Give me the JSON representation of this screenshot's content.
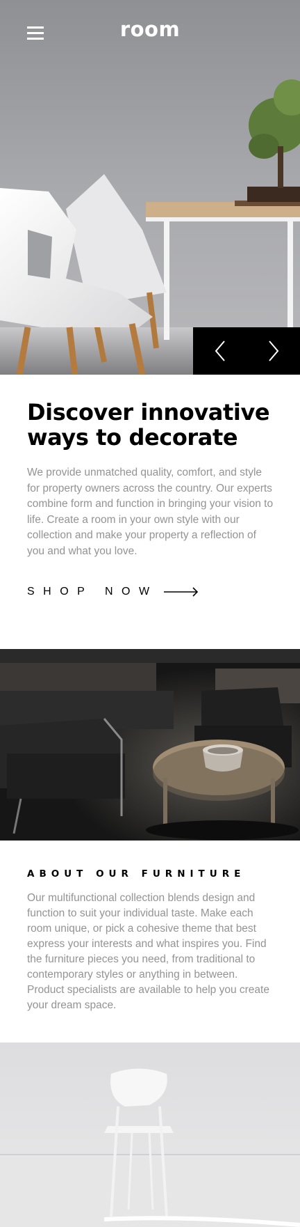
{
  "header": {
    "logo": "room",
    "menu_icon": "hamburger-menu-icon"
  },
  "slider": {
    "prev_icon": "chevron-left-icon",
    "next_icon": "chevron-right-icon"
  },
  "intro": {
    "title": "Discover innovative ways to decorate",
    "description": "We provide unmatched quality, comfort, and style for property owners across the country. Our experts combine form and function in bringing your vision to life. Create a room in your own style with our collection and make your property a reflection of you and what you love.",
    "cta_label": "SHOP NOW",
    "cta_icon": "arrow-right-icon"
  },
  "about": {
    "heading": "ABOUT OUR FURNITURE",
    "description": "Our multifunctional collection blends design and function to suit your individual taste. Make each room unique, or pick a cohesive theme that best express your interests and what inspires you. Find the furniture pieces you need, from traditional to contemporary styles or anything in between. Product specialists are available to help you create your dream space."
  },
  "colors": {
    "text_primary": "#000000",
    "text_muted": "#939393",
    "background": "#ffffff",
    "slider_controls": "#000000"
  }
}
